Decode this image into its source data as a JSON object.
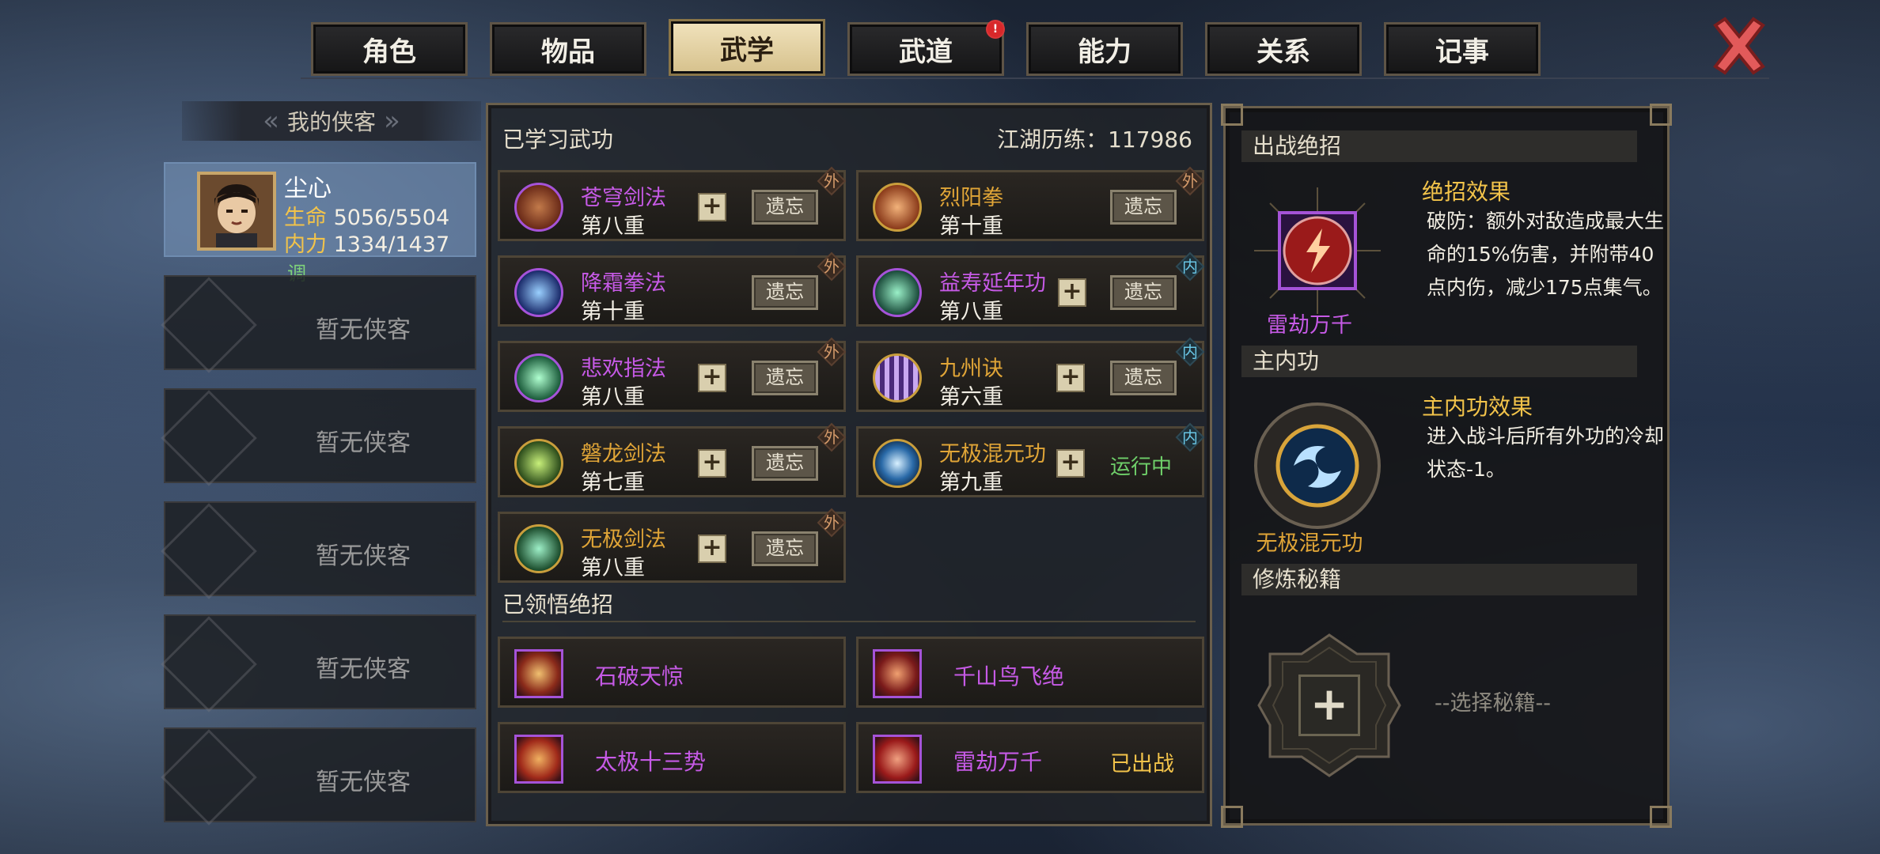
{
  "tabs": [
    {
      "label": "角色",
      "active": false,
      "alert": false
    },
    {
      "label": "物品",
      "active": false,
      "alert": false
    },
    {
      "label": "武学",
      "active": true,
      "alert": false
    },
    {
      "label": "武道",
      "active": false,
      "alert": true
    },
    {
      "label": "能力",
      "active": false,
      "alert": false
    },
    {
      "label": "关系",
      "active": false,
      "alert": false
    },
    {
      "label": "记事",
      "active": false,
      "alert": false
    }
  ],
  "alert_mark": "!",
  "left": {
    "title": "我的侠客",
    "hero": {
      "name": "尘心",
      "hp_label": "生命",
      "hp": "5056/5504",
      "mp_label": "内力",
      "mp": "1334/1437",
      "adjust": "调"
    },
    "empty_slots": [
      "暂无侠客",
      "暂无侠客",
      "暂无侠客",
      "暂无侠客",
      "暂无侠客"
    ]
  },
  "center": {
    "learned_title": "已学习武功",
    "experience": "江湖历练：117986",
    "skills": [
      {
        "name": "苍穹剑法",
        "level": "第八重",
        "tag": "外",
        "tag_type": "outer",
        "plus": true,
        "action": "遗忘",
        "name_color": "purple",
        "icon": "sword-icon"
      },
      {
        "name": "烈阳拳",
        "level": "第十重",
        "tag": "外",
        "tag_type": "outer",
        "plus": false,
        "action": "遗忘",
        "name_color": "gold",
        "icon": "fist-icon"
      },
      {
        "name": "降霜拳法",
        "level": "第十重",
        "tag": "外",
        "tag_type": "outer",
        "plus": false,
        "action": "遗忘",
        "name_color": "purple",
        "icon": "frost-fist-icon"
      },
      {
        "name": "益寿延年功",
        "level": "第八重",
        "tag": "内",
        "tag_type": "inner",
        "plus": true,
        "action": "遗忘",
        "name_color": "purple",
        "icon": "longevity-icon"
      },
      {
        "name": "悲欢指法",
        "level": "第八重",
        "tag": "外",
        "tag_type": "outer",
        "plus": true,
        "action": "遗忘",
        "name_color": "purple",
        "icon": "finger-icon"
      },
      {
        "name": "九州诀",
        "level": "第六重",
        "tag": "内",
        "tag_type": "inner",
        "plus": true,
        "action": "遗忘",
        "name_color": "gold",
        "icon": "pillar-icon"
      },
      {
        "name": "磐龙剑法",
        "level": "第七重",
        "tag": "外",
        "tag_type": "outer",
        "plus": true,
        "action": "遗忘",
        "name_color": "gold",
        "icon": "dragon-sword-icon"
      },
      {
        "name": "无极混元功",
        "level": "第九重",
        "tag": "内",
        "tag_type": "inner",
        "plus": true,
        "action": "运行中",
        "name_color": "gold",
        "icon": "swirl-icon"
      },
      {
        "name": "无极剑法",
        "level": "第八重",
        "tag": "外",
        "tag_type": "outer",
        "plus": true,
        "action": "遗忘",
        "name_color": "gold",
        "icon": "blades-icon"
      }
    ],
    "ultimates_title": "已领悟绝招",
    "ultimates": [
      {
        "name": "石破天惊",
        "status": ""
      },
      {
        "name": "千山鸟飞绝",
        "status": ""
      },
      {
        "name": "太极十三势",
        "status": ""
      },
      {
        "name": "雷劫万千",
        "status": "已出战"
      }
    ]
  },
  "right": {
    "ult_header": "出战绝招",
    "ult_name": "雷劫万千",
    "ult_effect_title": "绝招效果",
    "ult_effect_text": "破防：额外对敌造成最大生命的15%伤害，并附带40点内伤，减少175点集气。",
    "main_header": "主内功",
    "main_name": "无极混元功",
    "main_effect_title": "主内功效果",
    "main_effect_text": "进入战斗后所有外功的冷却状态-1。",
    "book_header": "修炼秘籍",
    "book_hint": "--选择秘籍--",
    "book_plus": "+"
  },
  "colors": {
    "purple_name": "#c65ae6",
    "gold_name": "#e0a537",
    "running": "#6fd06a",
    "deployed": "#f2c34a",
    "active_tab": "#e4d3a4"
  }
}
